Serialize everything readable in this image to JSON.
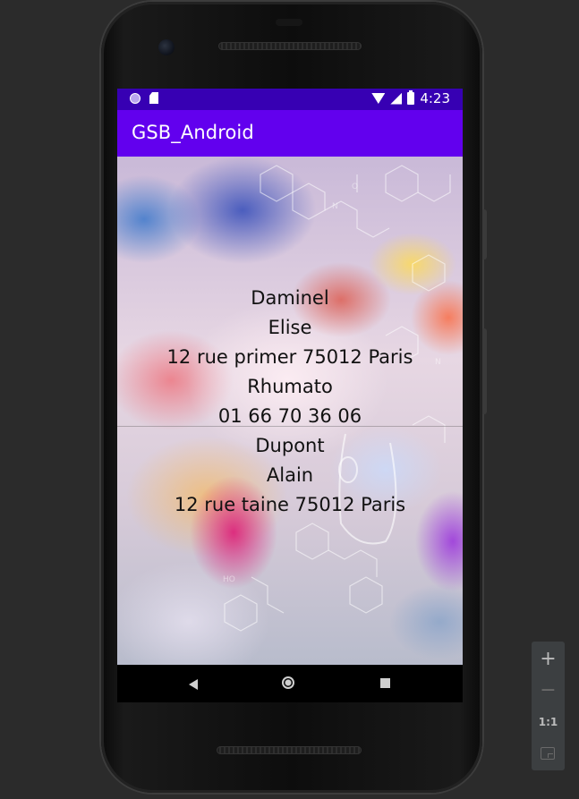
{
  "status_bar": {
    "time": "4:23"
  },
  "app_bar": {
    "title": "GSB_Android"
  },
  "records": [
    {
      "nom": "Daminel",
      "prenom": "Elise",
      "adresse": "12 rue primer 75012 Paris",
      "specialite": "Rhumato",
      "telephone": "01 66 70 36 06"
    },
    {
      "nom": "Dupont",
      "prenom": "Alain",
      "adresse": "12 rue taine 75012 Paris"
    }
  ],
  "zoom_panel": {
    "zoom_in_label": "+",
    "zoom_out_label": "−",
    "ratio_label": "1:1"
  },
  "colors": {
    "status_bar": "#3700b3",
    "app_bar": "#6200ee",
    "emulator_background": "#2b2b2b"
  },
  "icons": {
    "status_left": [
      "notification-dot-icon",
      "sd-card-icon"
    ],
    "status_right": [
      "wifi-icon",
      "signal-icon",
      "battery-icon"
    ],
    "navigation": [
      "back-icon",
      "home-icon",
      "recents-icon"
    ],
    "zoom_fit": "fit-screen-icon"
  }
}
